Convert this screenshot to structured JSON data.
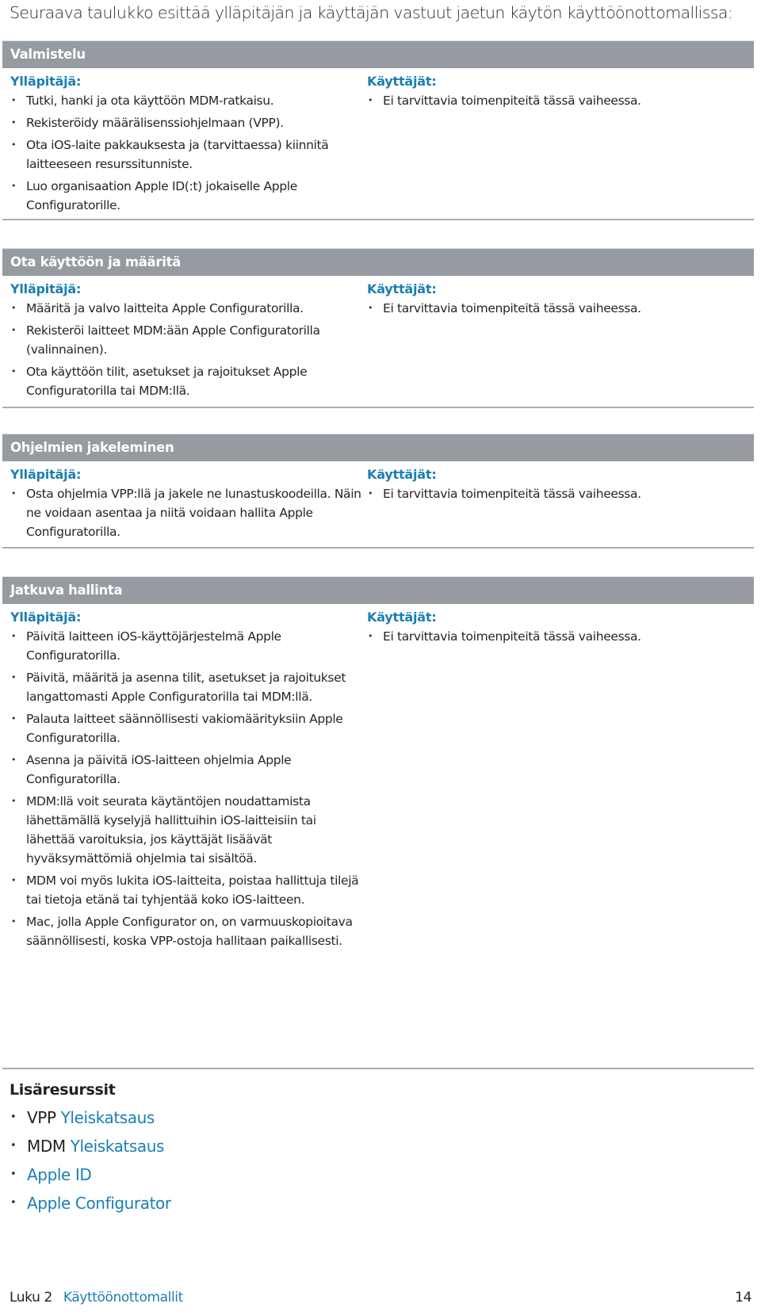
{
  "intro": "Seuraava taulukko esittää ylläpitäjän ja käyttäjän vastuut jaetun käytön käyttöönottomallissa:",
  "colors": {
    "band": "#959ba1",
    "accent": "#1a7fb3",
    "rule": "#a8adb1"
  },
  "sections": [
    {
      "title": "Valmistelu",
      "admin_label": "Ylläpitäjä:",
      "admin_items": [
        "Tutki, hanki ja ota käyttöön MDM-ratkaisu.",
        "Rekisteröidy määrälisenssiohjelmaan (VPP).",
        "Ota iOS-laite pakkauksesta ja (tarvittaessa) kiinnitä laitteeseen resurssitunniste.",
        "Luo organisaation Apple ID(:t) jokaiselle Apple Configuratorille."
      ],
      "user_label": "Käyttäjät:",
      "user_items": [
        "Ei tarvittavia toimenpiteitä tässä vaiheessa."
      ]
    },
    {
      "title": "Ota käyttöön ja määritä",
      "admin_label": "Ylläpitäjä:",
      "admin_items": [
        "Määritä ja valvo laitteita Apple Configuratorilla.",
        "Rekisteröi laitteet MDM:ään Apple Configuratorilla (valinnainen).",
        "Ota käyttöön tilit, asetukset ja rajoitukset Apple Configuratorilla tai MDM:llä."
      ],
      "user_label": "Käyttäjät:",
      "user_items": [
        "Ei tarvittavia toimenpiteitä tässä vaiheessa."
      ]
    },
    {
      "title": "Ohjelmien jakeleminen",
      "admin_label": "Ylläpitäjä:",
      "admin_items": [
        "Osta ohjelmia VPP:llä ja jakele ne lunastuskoodeilla. Näin ne voidaan asentaa ja niitä voidaan hallita Apple Configuratorilla."
      ],
      "user_label": "Käyttäjät:",
      "user_items": [
        "Ei tarvittavia toimenpiteitä tässä vaiheessa."
      ]
    },
    {
      "title": "Jatkuva hallinta",
      "admin_label": "Ylläpitäjä:",
      "admin_items": [
        "Päivitä laitteen iOS-käyttöjärjestelmä Apple Configuratorilla.",
        "Päivitä, määritä ja asenna tilit, asetukset ja rajoitukset langattomasti Apple Configuratorilla tai MDM:llä.",
        "Palauta laitteet säännöllisesti vakiomäärityksiin Apple Configuratorilla.",
        "Asenna ja päivitä iOS-laitteen ohjelmia Apple Configuratorilla.",
        "MDM:llä voit seurata käytäntöjen noudattamista lähettämällä kyselyjä hallittuihin iOS-laitteisiin tai lähettää varoituksia, jos käyttäjät lisäävät hyväksymättömiä ohjelmia tai sisältöä.",
        "MDM voi myös lukita iOS-laitteita, poistaa hallittuja tilejä tai tietoja etänä tai tyhjentää koko iOS-laitteen.",
        "Mac, jolla Apple Configurator on, on varmuuskopioitava säännöllisesti, koska VPP-ostoja hallitaan paikallisesti."
      ],
      "user_label": "Käyttäjät:",
      "user_items": [
        "Ei tarvittavia toimenpiteitä tässä vaiheessa."
      ]
    }
  ],
  "resources": {
    "heading": "Lisäresurssit",
    "items": [
      {
        "prefix": "VPP",
        "link": "Yleiskatsaus"
      },
      {
        "prefix": "MDM",
        "link": "Yleiskatsaus"
      },
      {
        "prefix": "",
        "link": "Apple ID"
      },
      {
        "prefix": "",
        "link": "Apple Configurator"
      }
    ]
  },
  "footer": {
    "chapter": "Luku 2",
    "chapter_title": "Käyttöönottomallit",
    "page": "14"
  }
}
